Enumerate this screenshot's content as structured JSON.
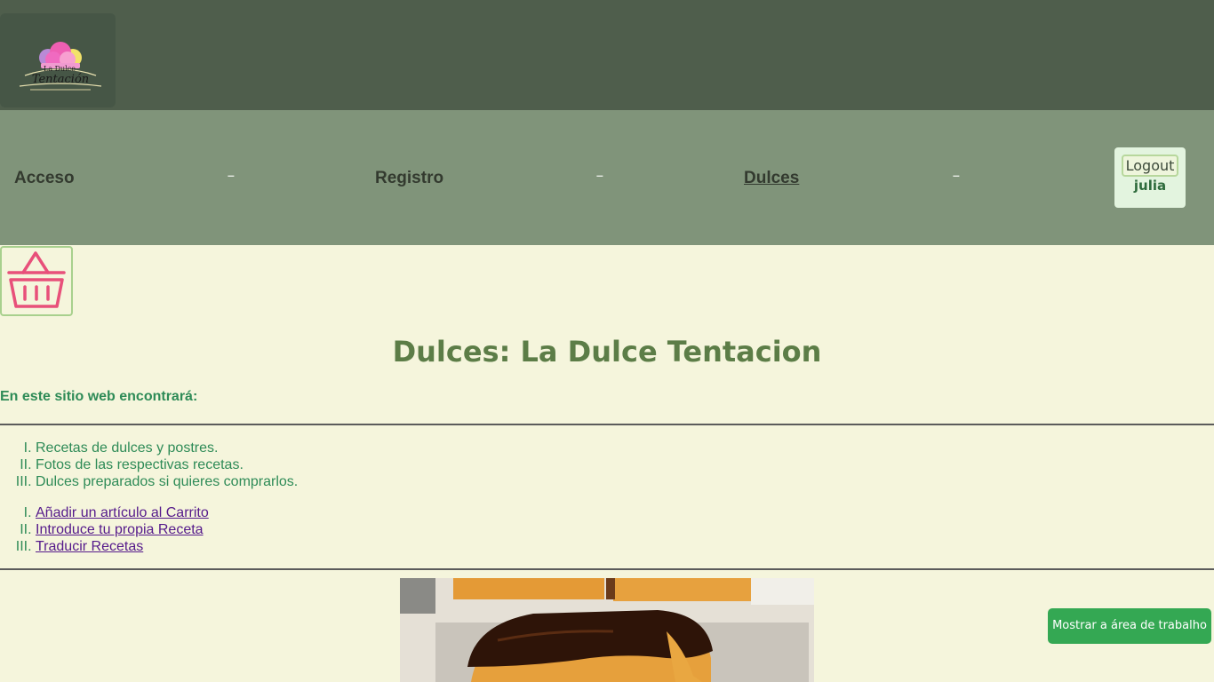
{
  "brand": {
    "logo_alt": "La Dulce Tentación"
  },
  "nav": {
    "items": [
      {
        "label": "Acceso"
      },
      {
        "label": "Registro"
      },
      {
        "label": "Dulces"
      }
    ],
    "separator": "–",
    "logout_label": "Logout",
    "username": "julia"
  },
  "cart": {
    "icon": "basket-icon"
  },
  "main": {
    "title": "Dulces: La Dulce Tentacion",
    "intro": "En este sitio web encontrará:",
    "features": [
      "Recetas de dulces y postres.",
      "Fotos de las respectivas recetas.",
      "Dulces preparados si quieres comprarlos."
    ],
    "links": [
      "Añadir un artículo al Carrito",
      "Introduce tu propia Receta",
      "Traducir Recetas"
    ]
  },
  "overlay": {
    "desktop_button": "Mostrar a área de trabalho"
  },
  "colors": {
    "header_bg": "#4f5e4c",
    "nav_bg": "#80947a",
    "page_bg": "#f5f5dc",
    "title_green": "#5c7d47",
    "text_green": "#2e8b57",
    "cart_pink": "#e8507a",
    "button_green": "#34a853"
  }
}
